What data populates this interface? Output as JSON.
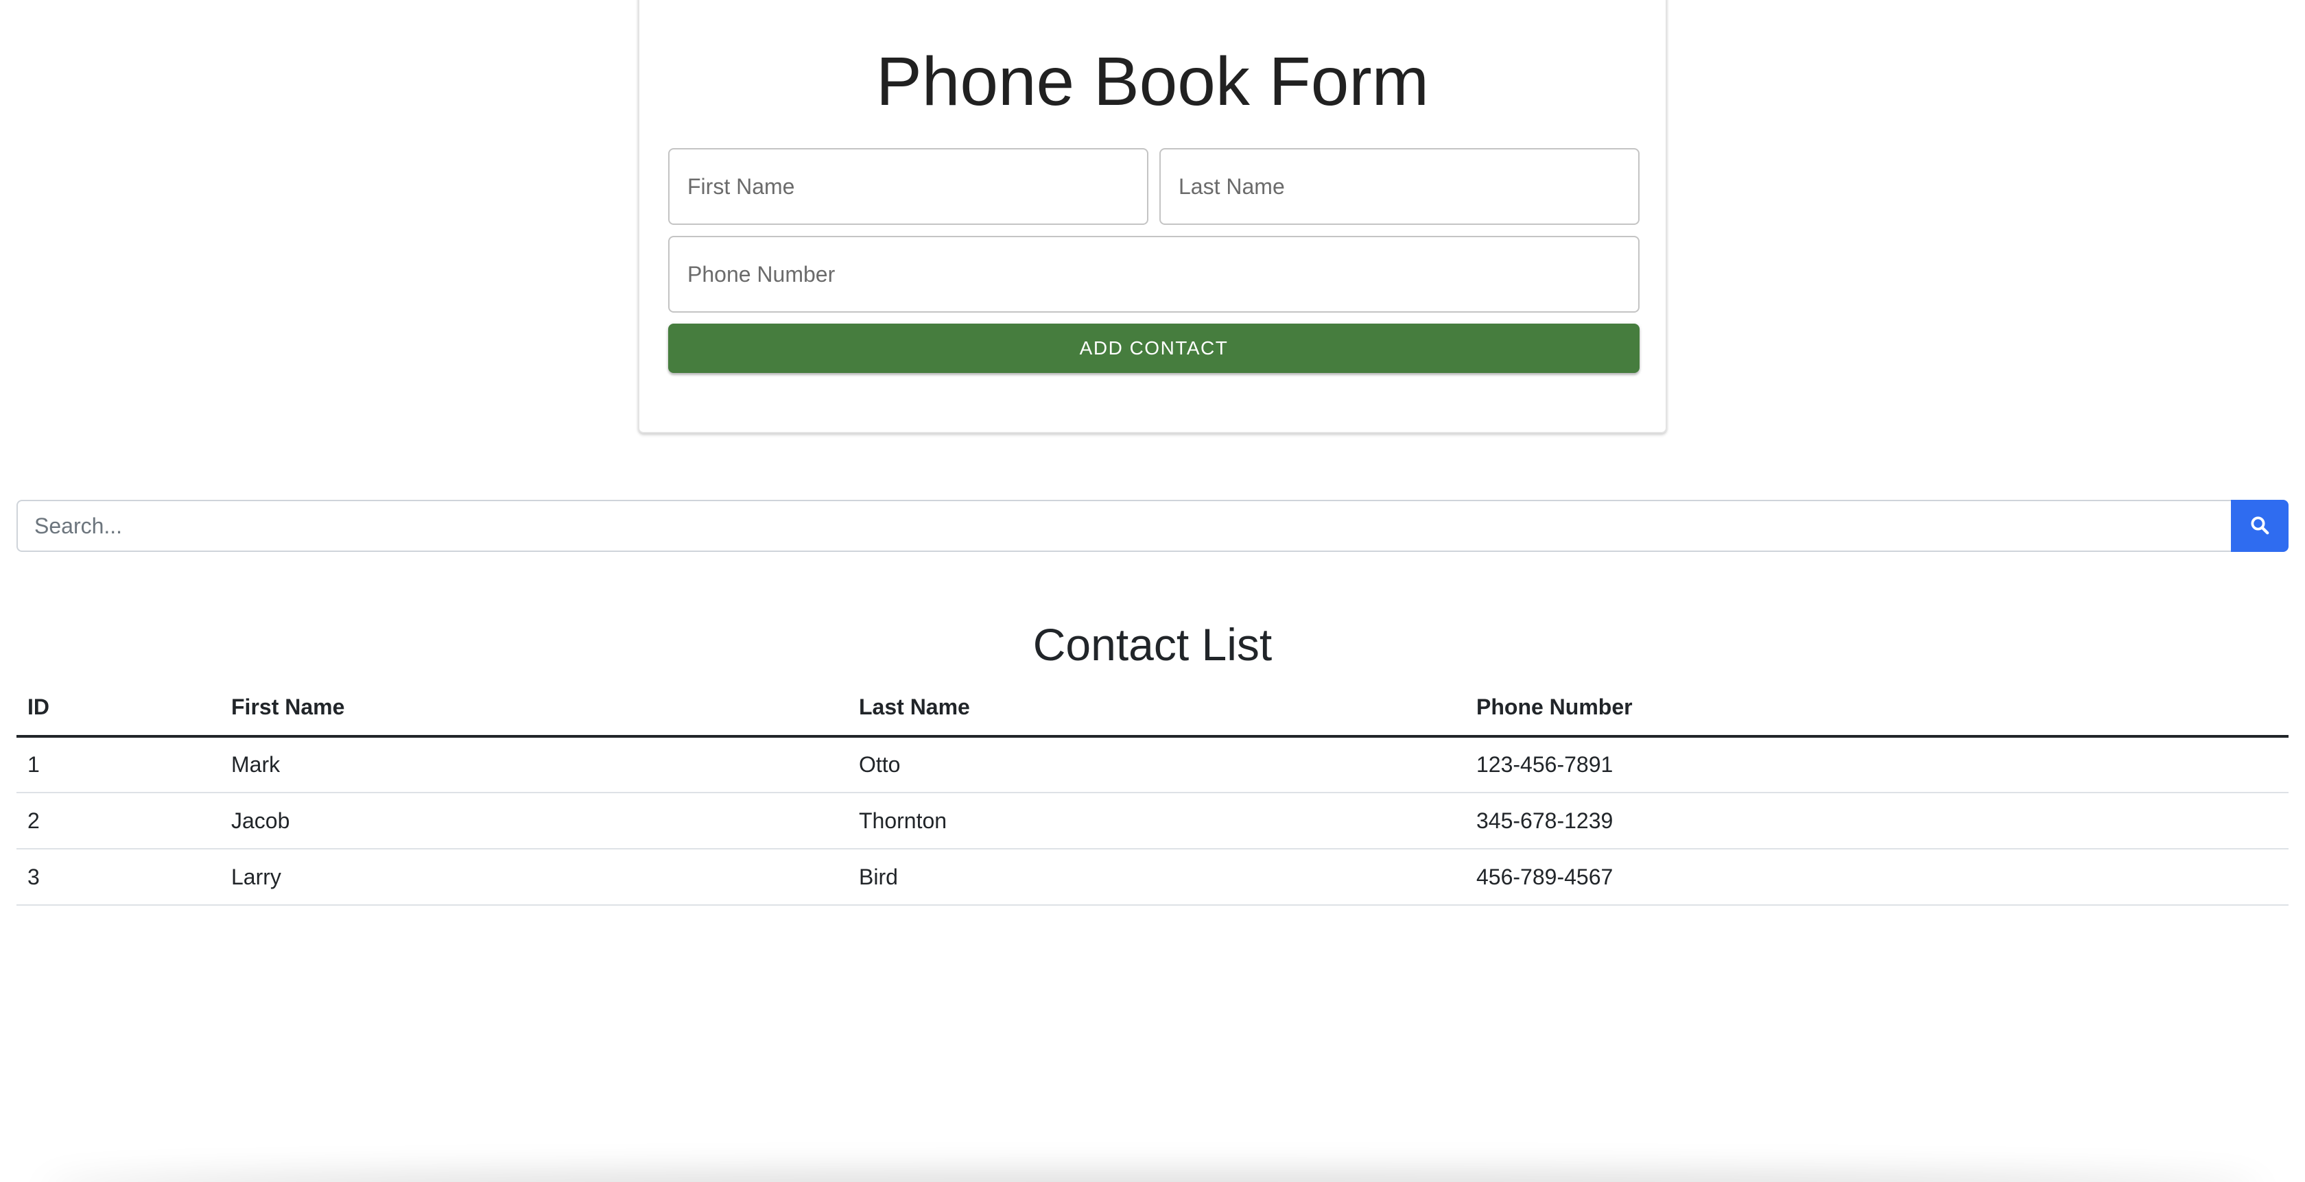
{
  "form": {
    "title": "Phone Book Form",
    "first_name_placeholder": "First Name",
    "last_name_placeholder": "Last Name",
    "phone_placeholder": "Phone Number",
    "add_button_label": "ADD CONTACT",
    "button_color": "#467d3e"
  },
  "search": {
    "placeholder": "Search...",
    "button_icon": "search-icon",
    "button_color": "#2f6cf0"
  },
  "contacts": {
    "title": "Contact List",
    "headers": [
      "ID",
      "First Name",
      "Last Name",
      "Phone Number"
    ],
    "rows": [
      [
        "1",
        "Mark",
        "Otto",
        "123-456-7891"
      ],
      [
        "2",
        "Jacob",
        "Thornton",
        "345-678-1239"
      ],
      [
        "3",
        "Larry",
        "Bird",
        "456-789-4567"
      ]
    ]
  }
}
